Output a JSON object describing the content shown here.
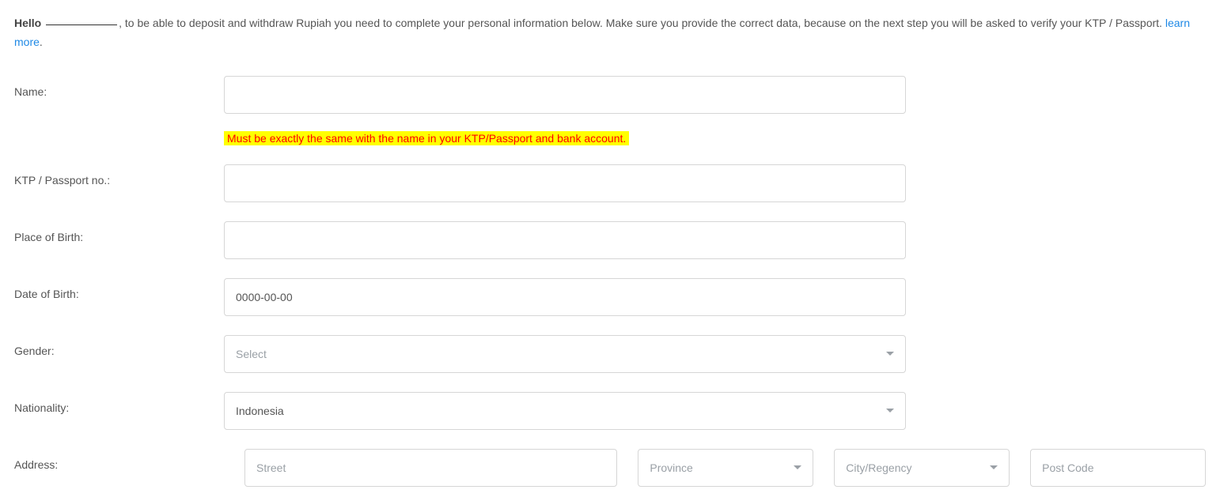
{
  "intro": {
    "hello": "Hello",
    "username": "",
    "text_after_comma": ", to be able to deposit and withdraw Rupiah you need to complete your personal information below. Make sure you provide the correct data, because on the next step you will be asked to verify your KTP / Passport. ",
    "learn_more": "learn more",
    "period": "."
  },
  "form": {
    "name": {
      "label": "Name:",
      "value": "",
      "helper": "Must be exactly the same with the name in your KTP/Passport and bank account."
    },
    "ktp": {
      "label": "KTP / Passport no.:",
      "value": ""
    },
    "pob": {
      "label": "Place of Birth:",
      "value": ""
    },
    "dob": {
      "label": "Date of Birth:",
      "value": "0000-00-00"
    },
    "gender": {
      "label": "Gender:",
      "selected": "Select",
      "placeholder_mode": true
    },
    "nationality": {
      "label": "Nationality:",
      "selected": "Indonesia",
      "placeholder_mode": false
    },
    "address": {
      "label": "Address:",
      "street_placeholder": "Street",
      "street_value": "",
      "province_selected": "Province",
      "province_placeholder_mode": true,
      "city_selected": "City/Regency",
      "city_placeholder_mode": true,
      "post_placeholder": "Post Code",
      "post_value": ""
    }
  }
}
